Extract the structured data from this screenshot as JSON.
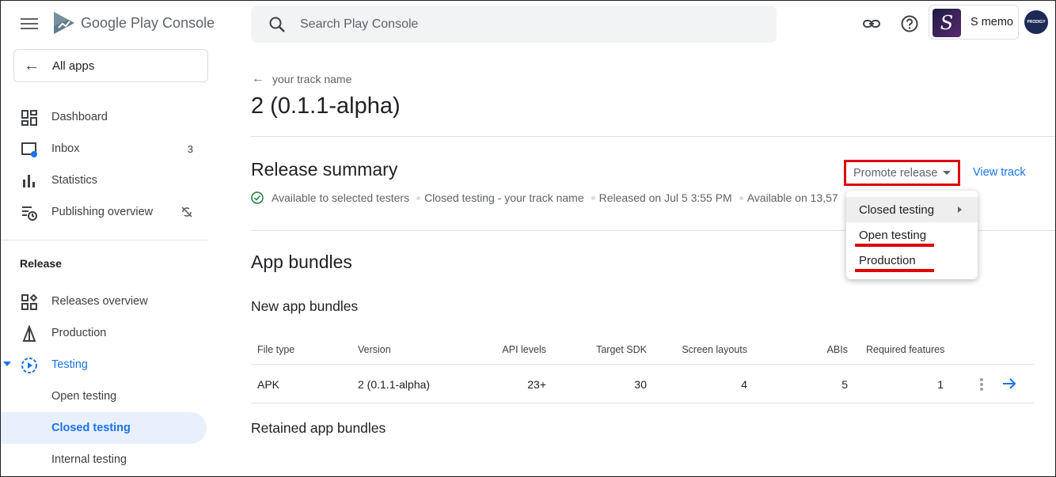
{
  "header": {
    "brand": "Google Play Console",
    "search_placeholder": "Search Play Console",
    "app_name": "S memo",
    "app_initial": "S",
    "avatar_text": "PRODIGY"
  },
  "sidebar": {
    "all_apps": "All apps",
    "items": [
      {
        "label": "Dashboard",
        "icon": "dashboard-icon"
      },
      {
        "label": "Inbox",
        "icon": "inbox-icon",
        "badge": "3"
      },
      {
        "label": "Statistics",
        "icon": "bar-chart-icon"
      },
      {
        "label": "Publishing overview",
        "icon": "publishing-icon"
      }
    ],
    "release_section": "Release",
    "release_items": [
      {
        "label": "Releases overview",
        "icon": "releases-icon"
      },
      {
        "label": "Production",
        "icon": "production-icon"
      },
      {
        "label": "Testing",
        "icon": "testing-icon"
      }
    ],
    "testing_sub": [
      "Open testing",
      "Closed testing",
      "Internal testing"
    ]
  },
  "main": {
    "back_label": "your track name",
    "title": "2 (0.1.1-alpha)",
    "release_summary": "Release summary",
    "meta": [
      "Available to selected testers",
      "Closed testing - your track name",
      "Released on Jul 5 3:55 PM",
      "Available on 13,57"
    ],
    "promote_label": "Promote release",
    "view_track": "View track",
    "promote_menu": [
      "Closed testing",
      "Open testing",
      "Production"
    ],
    "app_bundles": "App bundles",
    "new_app_bundles": "New app bundles",
    "retained_app_bundles": "Retained app bundles",
    "table": {
      "headers": [
        "File type",
        "Version",
        "API levels",
        "Target SDK",
        "Screen layouts",
        "ABIs",
        "Required features"
      ],
      "rows": [
        [
          "APK",
          "2 (0.1.1-alpha)",
          "23+",
          "30",
          "4",
          "5",
          "1"
        ]
      ]
    }
  },
  "colors": {
    "accent": "#1a73e8",
    "highlight": "#e00000",
    "active_bg": "#e8f0fe"
  }
}
